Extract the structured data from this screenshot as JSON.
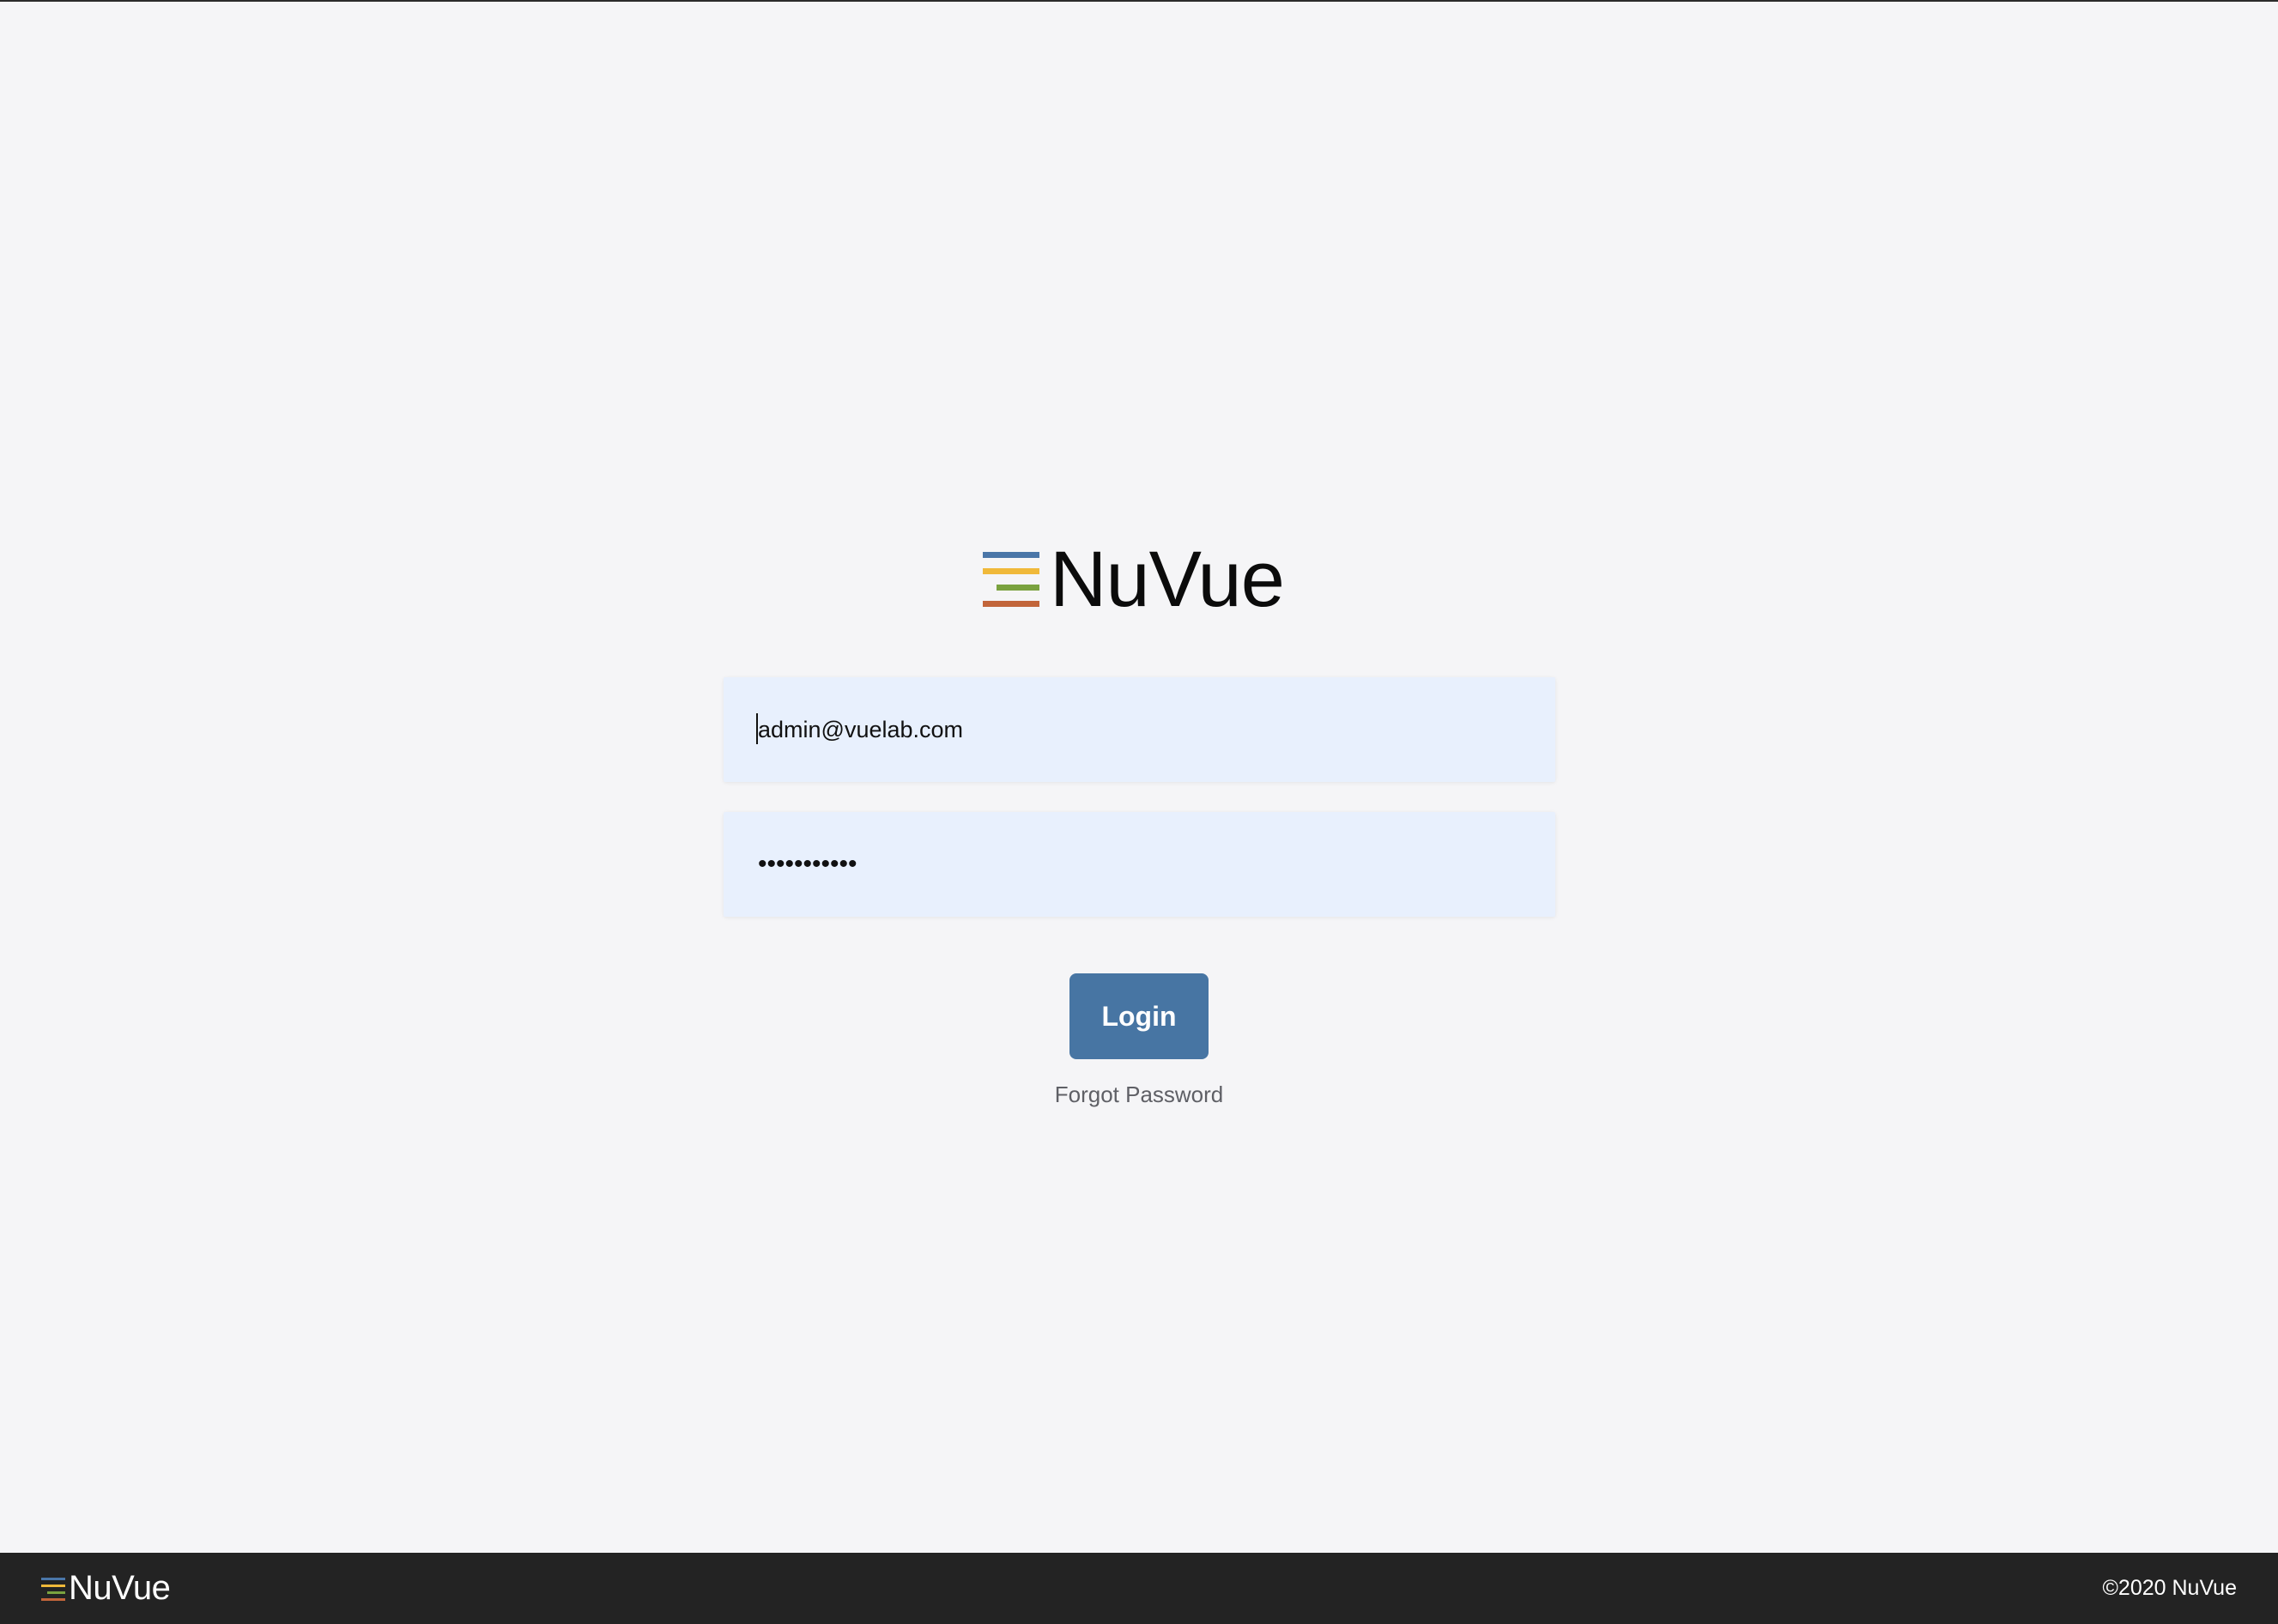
{
  "brand": {
    "name": "NuVue",
    "icon": "stacked-lines-logo-icon",
    "bar_colors": [
      "#4a76a8",
      "#f0b93a",
      "#7aa23f",
      "#c2653a"
    ]
  },
  "login_form": {
    "email_value": "admin@vuelab.com",
    "password_masked": "•••••••••••",
    "login_label": "Login",
    "forgot_password_label": "Forgot Password"
  },
  "footer": {
    "brand": "NuVue",
    "copyright": "©2020 NuVue"
  },
  "colors": {
    "page_background": "#f5f5f7",
    "field_background": "#e8f0fd",
    "button_background": "#4775a3",
    "footer_background": "#232323"
  }
}
